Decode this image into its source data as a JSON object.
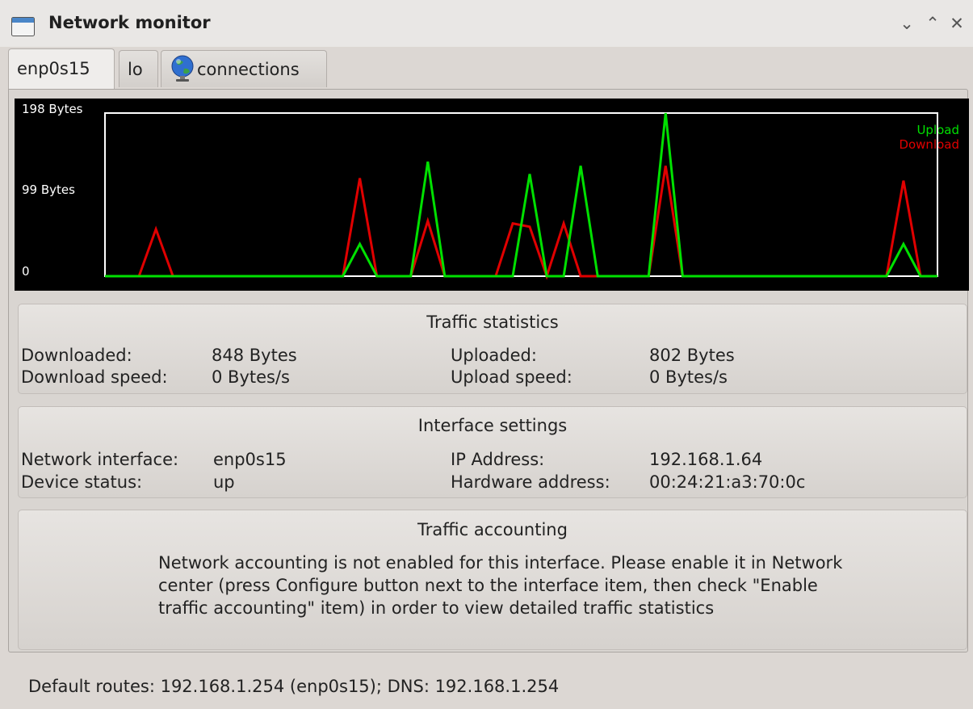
{
  "window": {
    "title": "Network monitor"
  },
  "tabs": [
    {
      "label": "enp0s15"
    },
    {
      "label": "lo"
    },
    {
      "label": "connections"
    }
  ],
  "colors": {
    "upload": "#00e000",
    "download": "#e00000",
    "graph_bg": "#000000"
  },
  "chart_data": {
    "type": "line",
    "y_ticks": [
      "198 Bytes",
      "99 Bytes",
      "0"
    ],
    "ylim": [
      0,
      198
    ],
    "legend": [
      "Upload",
      "Download"
    ],
    "legend_position": "top-right",
    "x": [
      0,
      1,
      2,
      3,
      4,
      5,
      6,
      7,
      8,
      9,
      10,
      11,
      12,
      13,
      14,
      15,
      16,
      17,
      18,
      19,
      20,
      21,
      22,
      23,
      24,
      25,
      26,
      27,
      28,
      29,
      30,
      31,
      32,
      33,
      34,
      35,
      36,
      37,
      38,
      39,
      40,
      41,
      42,
      43,
      44,
      45,
      46,
      47,
      48,
      49
    ],
    "series": [
      {
        "name": "Download",
        "values": [
          0,
          0,
          0,
          57,
          0,
          0,
          0,
          0,
          0,
          0,
          0,
          0,
          0,
          0,
          0,
          119,
          0,
          0,
          0,
          67,
          0,
          0,
          0,
          0,
          64,
          60,
          0,
          64,
          0,
          0,
          0,
          0,
          0,
          134,
          0,
          0,
          0,
          0,
          0,
          0,
          0,
          0,
          0,
          0,
          0,
          0,
          0,
          116,
          0,
          0
        ]
      },
      {
        "name": "Upload",
        "values": [
          0,
          0,
          0,
          0,
          0,
          0,
          0,
          0,
          0,
          0,
          0,
          0,
          0,
          0,
          0,
          39,
          0,
          0,
          0,
          139,
          0,
          0,
          0,
          0,
          0,
          124,
          0,
          0,
          134,
          0,
          0,
          0,
          0,
          198,
          0,
          0,
          0,
          0,
          0,
          0,
          0,
          0,
          0,
          0,
          0,
          0,
          0,
          39,
          0,
          0
        ]
      }
    ]
  },
  "traffic": {
    "title": "Traffic statistics",
    "downloaded_label": "Downloaded:",
    "downloaded_value": "848 Bytes",
    "download_speed_label": "Download speed:",
    "download_speed_value": "0 Bytes/s",
    "uploaded_label": "Uploaded:",
    "uploaded_value": "802 Bytes",
    "upload_speed_label": "Upload speed:",
    "upload_speed_value": "0 Bytes/s"
  },
  "interface": {
    "title": "Interface settings",
    "network_interface_label": "Network interface:",
    "network_interface_value": "enp0s15",
    "device_status_label": "Device status:",
    "device_status_value": "up",
    "ip_label": "IP Address:",
    "ip_value": "192.168.1.64",
    "hw_label": "Hardware address:",
    "hw_value": "00:24:21:a3:70:0c"
  },
  "accounting": {
    "title": "Traffic accounting",
    "message": "Network accounting is not enabled for this interface. Please enable it in Network center (press Configure button next to the interface item, then check \"Enable traffic accounting\" item) in order to view detailed traffic statistics"
  },
  "status_bar": {
    "text": "Default routes: 192.168.1.254 (enp0s15); DNS: 192.168.1.254"
  }
}
